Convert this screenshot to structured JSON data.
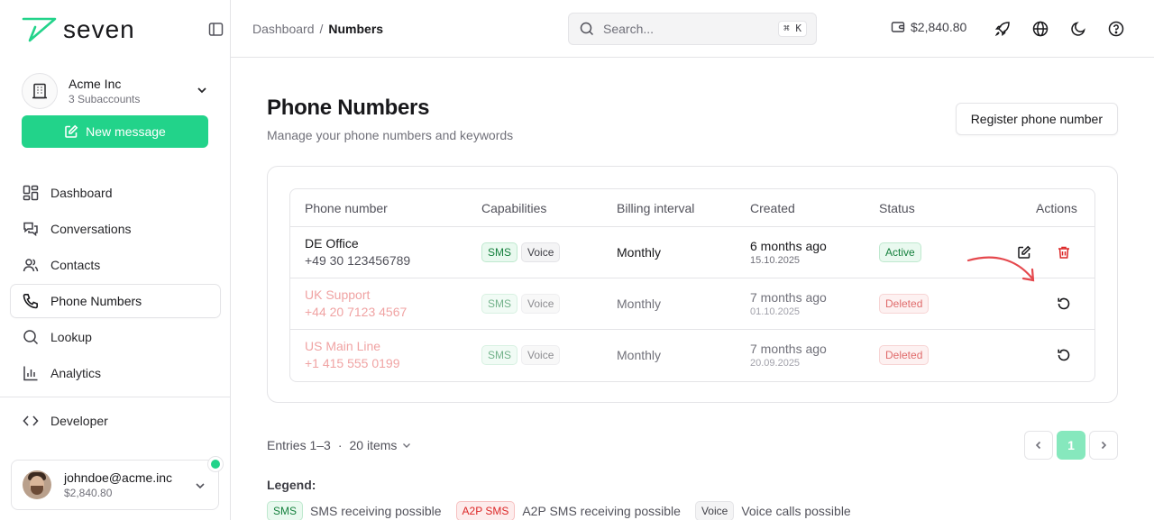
{
  "brand": {
    "name": "seven"
  },
  "account": {
    "name": "Acme Inc",
    "sub": "3 Subaccounts"
  },
  "new_message_label": "New message",
  "nav": [
    {
      "label": "Dashboard",
      "icon": "dashboard-icon"
    },
    {
      "label": "Conversations",
      "icon": "conversations-icon"
    },
    {
      "label": "Contacts",
      "icon": "contacts-icon"
    },
    {
      "label": "Phone Numbers",
      "icon": "phone-icon",
      "active": true
    },
    {
      "label": "Lookup",
      "icon": "search-icon"
    },
    {
      "label": "Analytics",
      "icon": "analytics-icon"
    }
  ],
  "developer_label": "Developer",
  "user": {
    "email": "johndoe@acme.inc",
    "balance": "$2,840.80",
    "status_color": "#22d38a"
  },
  "breadcrumb": {
    "root": "Dashboard",
    "sep": "/",
    "current": "Numbers"
  },
  "search": {
    "placeholder": "Search...",
    "shortcut": "⌘ K"
  },
  "balance": "$2,840.80",
  "page": {
    "title": "Phone Numbers",
    "subtitle": "Manage your phone numbers and keywords",
    "register_button": "Register phone number"
  },
  "table": {
    "columns": [
      "Phone number",
      "Capabilities",
      "Billing interval",
      "Created",
      "Status",
      "Actions"
    ],
    "rows": [
      {
        "name": "DE Office",
        "number": "+49 30 123456789",
        "caps": [
          "SMS",
          "Voice"
        ],
        "billing": "Monthly",
        "created_rel": "6 months ago",
        "created_date": "15.10.2025",
        "status": "Active"
      },
      {
        "name": "UK Support",
        "number": "+44 20 7123 4567",
        "caps": [
          "SMS",
          "Voice"
        ],
        "billing": "Monthly",
        "created_rel": "7 months ago",
        "created_date": "01.10.2025",
        "status": "Deleted"
      },
      {
        "name": "US Main Line",
        "number": "+1 415 555 0199",
        "caps": [
          "SMS",
          "Voice"
        ],
        "billing": "Monthly",
        "created_rel": "7 months ago",
        "created_date": "20.09.2025",
        "status": "Deleted"
      }
    ]
  },
  "pagination": {
    "entries": "Entries 1–3",
    "dot": "·",
    "per_page": "20 items",
    "current_page": "1"
  },
  "legend": {
    "title": "Legend:",
    "items": [
      {
        "badge": "SMS",
        "text": "SMS receiving possible"
      },
      {
        "badge": "A2P SMS",
        "text": "A2P SMS receiving possible"
      },
      {
        "badge": "Voice",
        "text": "Voice calls possible"
      }
    ]
  },
  "colors": {
    "accent": "#22d38a",
    "danger": "#dc2626"
  }
}
